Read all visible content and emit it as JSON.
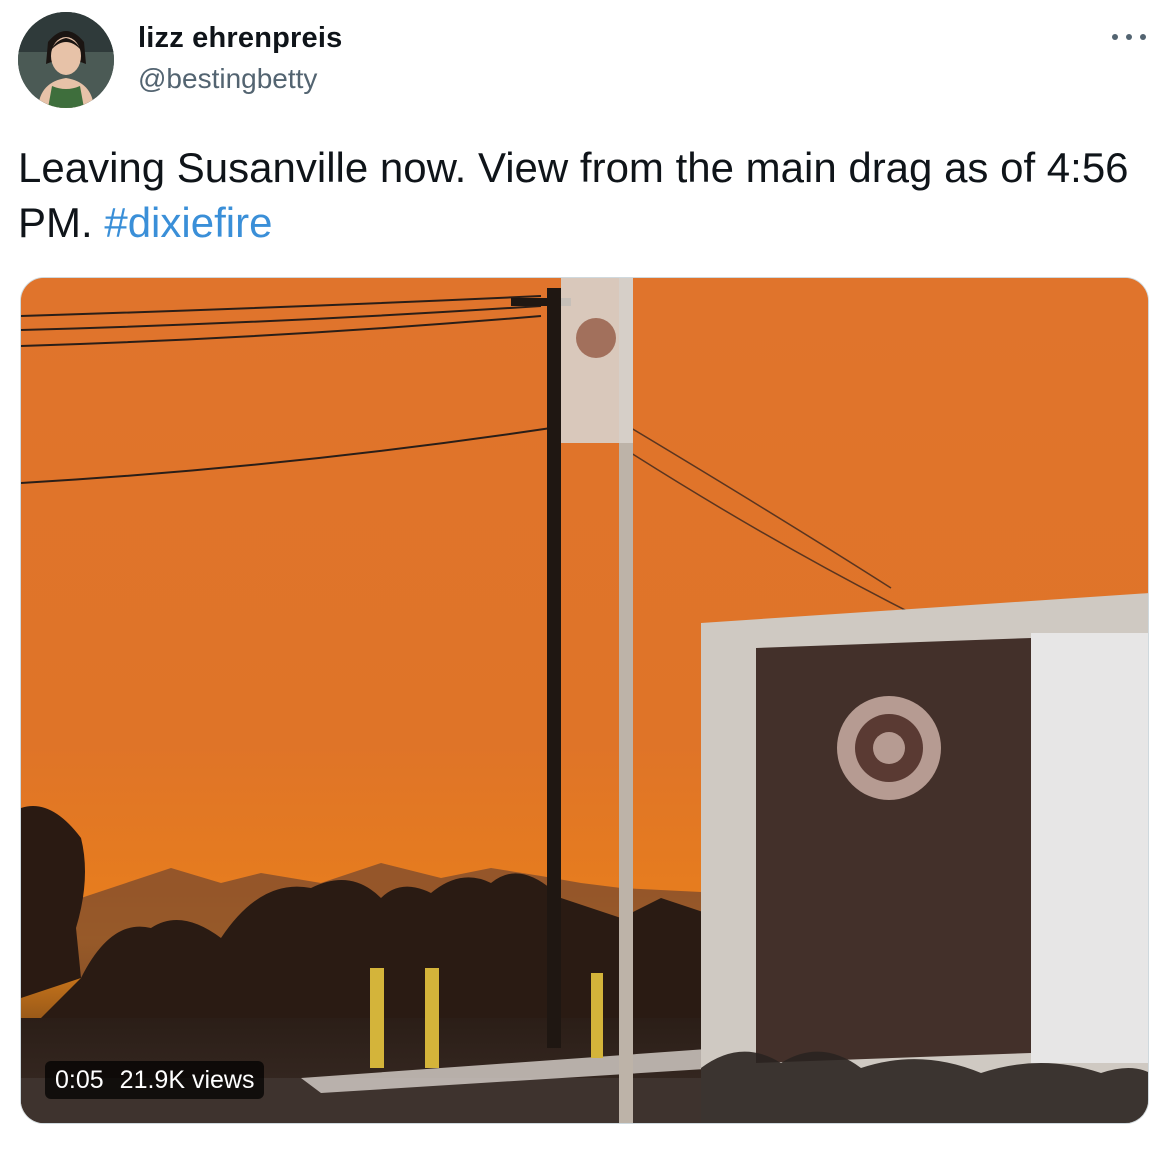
{
  "author": {
    "display_name": "lizz ehrenpreis",
    "handle": "@bestingbetty",
    "avatar_icon": "profile-photo"
  },
  "tweet": {
    "text": "Leaving Susanville now. View from the main drag as of 4:56 PM.",
    "hashtag": "#dixiefire"
  },
  "menu": {
    "icon": "more-horizontal-icon"
  },
  "video": {
    "duration": "0:05",
    "views": "21.9K views"
  },
  "colors": {
    "text": "#0f1419",
    "secondary": "#536471",
    "link": "#3a8fd8",
    "sky": "#e57a2f"
  }
}
